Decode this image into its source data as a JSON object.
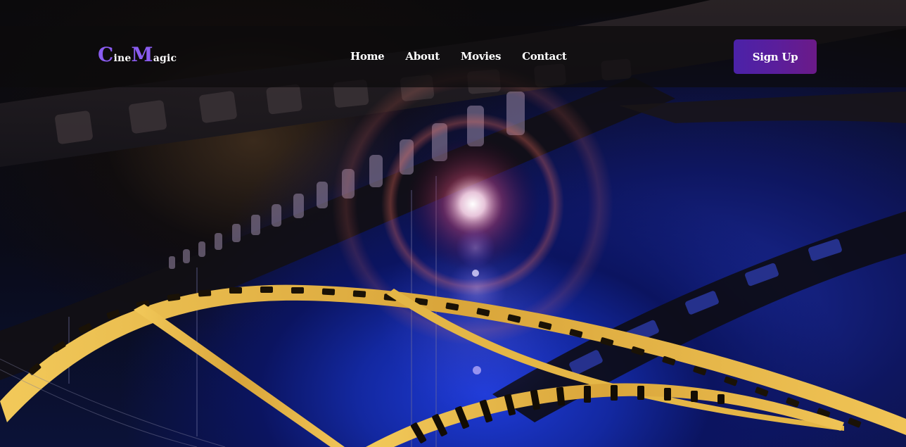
{
  "logo": {
    "part1_cap": "C",
    "part1_rest": "ine",
    "part2_cap": "M",
    "part2_rest": "agic"
  },
  "nav": {
    "items": [
      {
        "label": "Home"
      },
      {
        "label": "About"
      },
      {
        "label": "Movies"
      },
      {
        "label": "Contact"
      }
    ]
  },
  "cta": {
    "signup_label": "Sign Up"
  },
  "colors": {
    "accent": "#8a5cf0",
    "button_start": "#4b22a8",
    "button_end": "#6b1a88",
    "navbar_bg": "#0c0b0c",
    "film_gold": "#e8b94a",
    "backdrop_blue": "#1e3bd8"
  },
  "hero": {
    "background_image": "film-reel-lens-flare"
  }
}
